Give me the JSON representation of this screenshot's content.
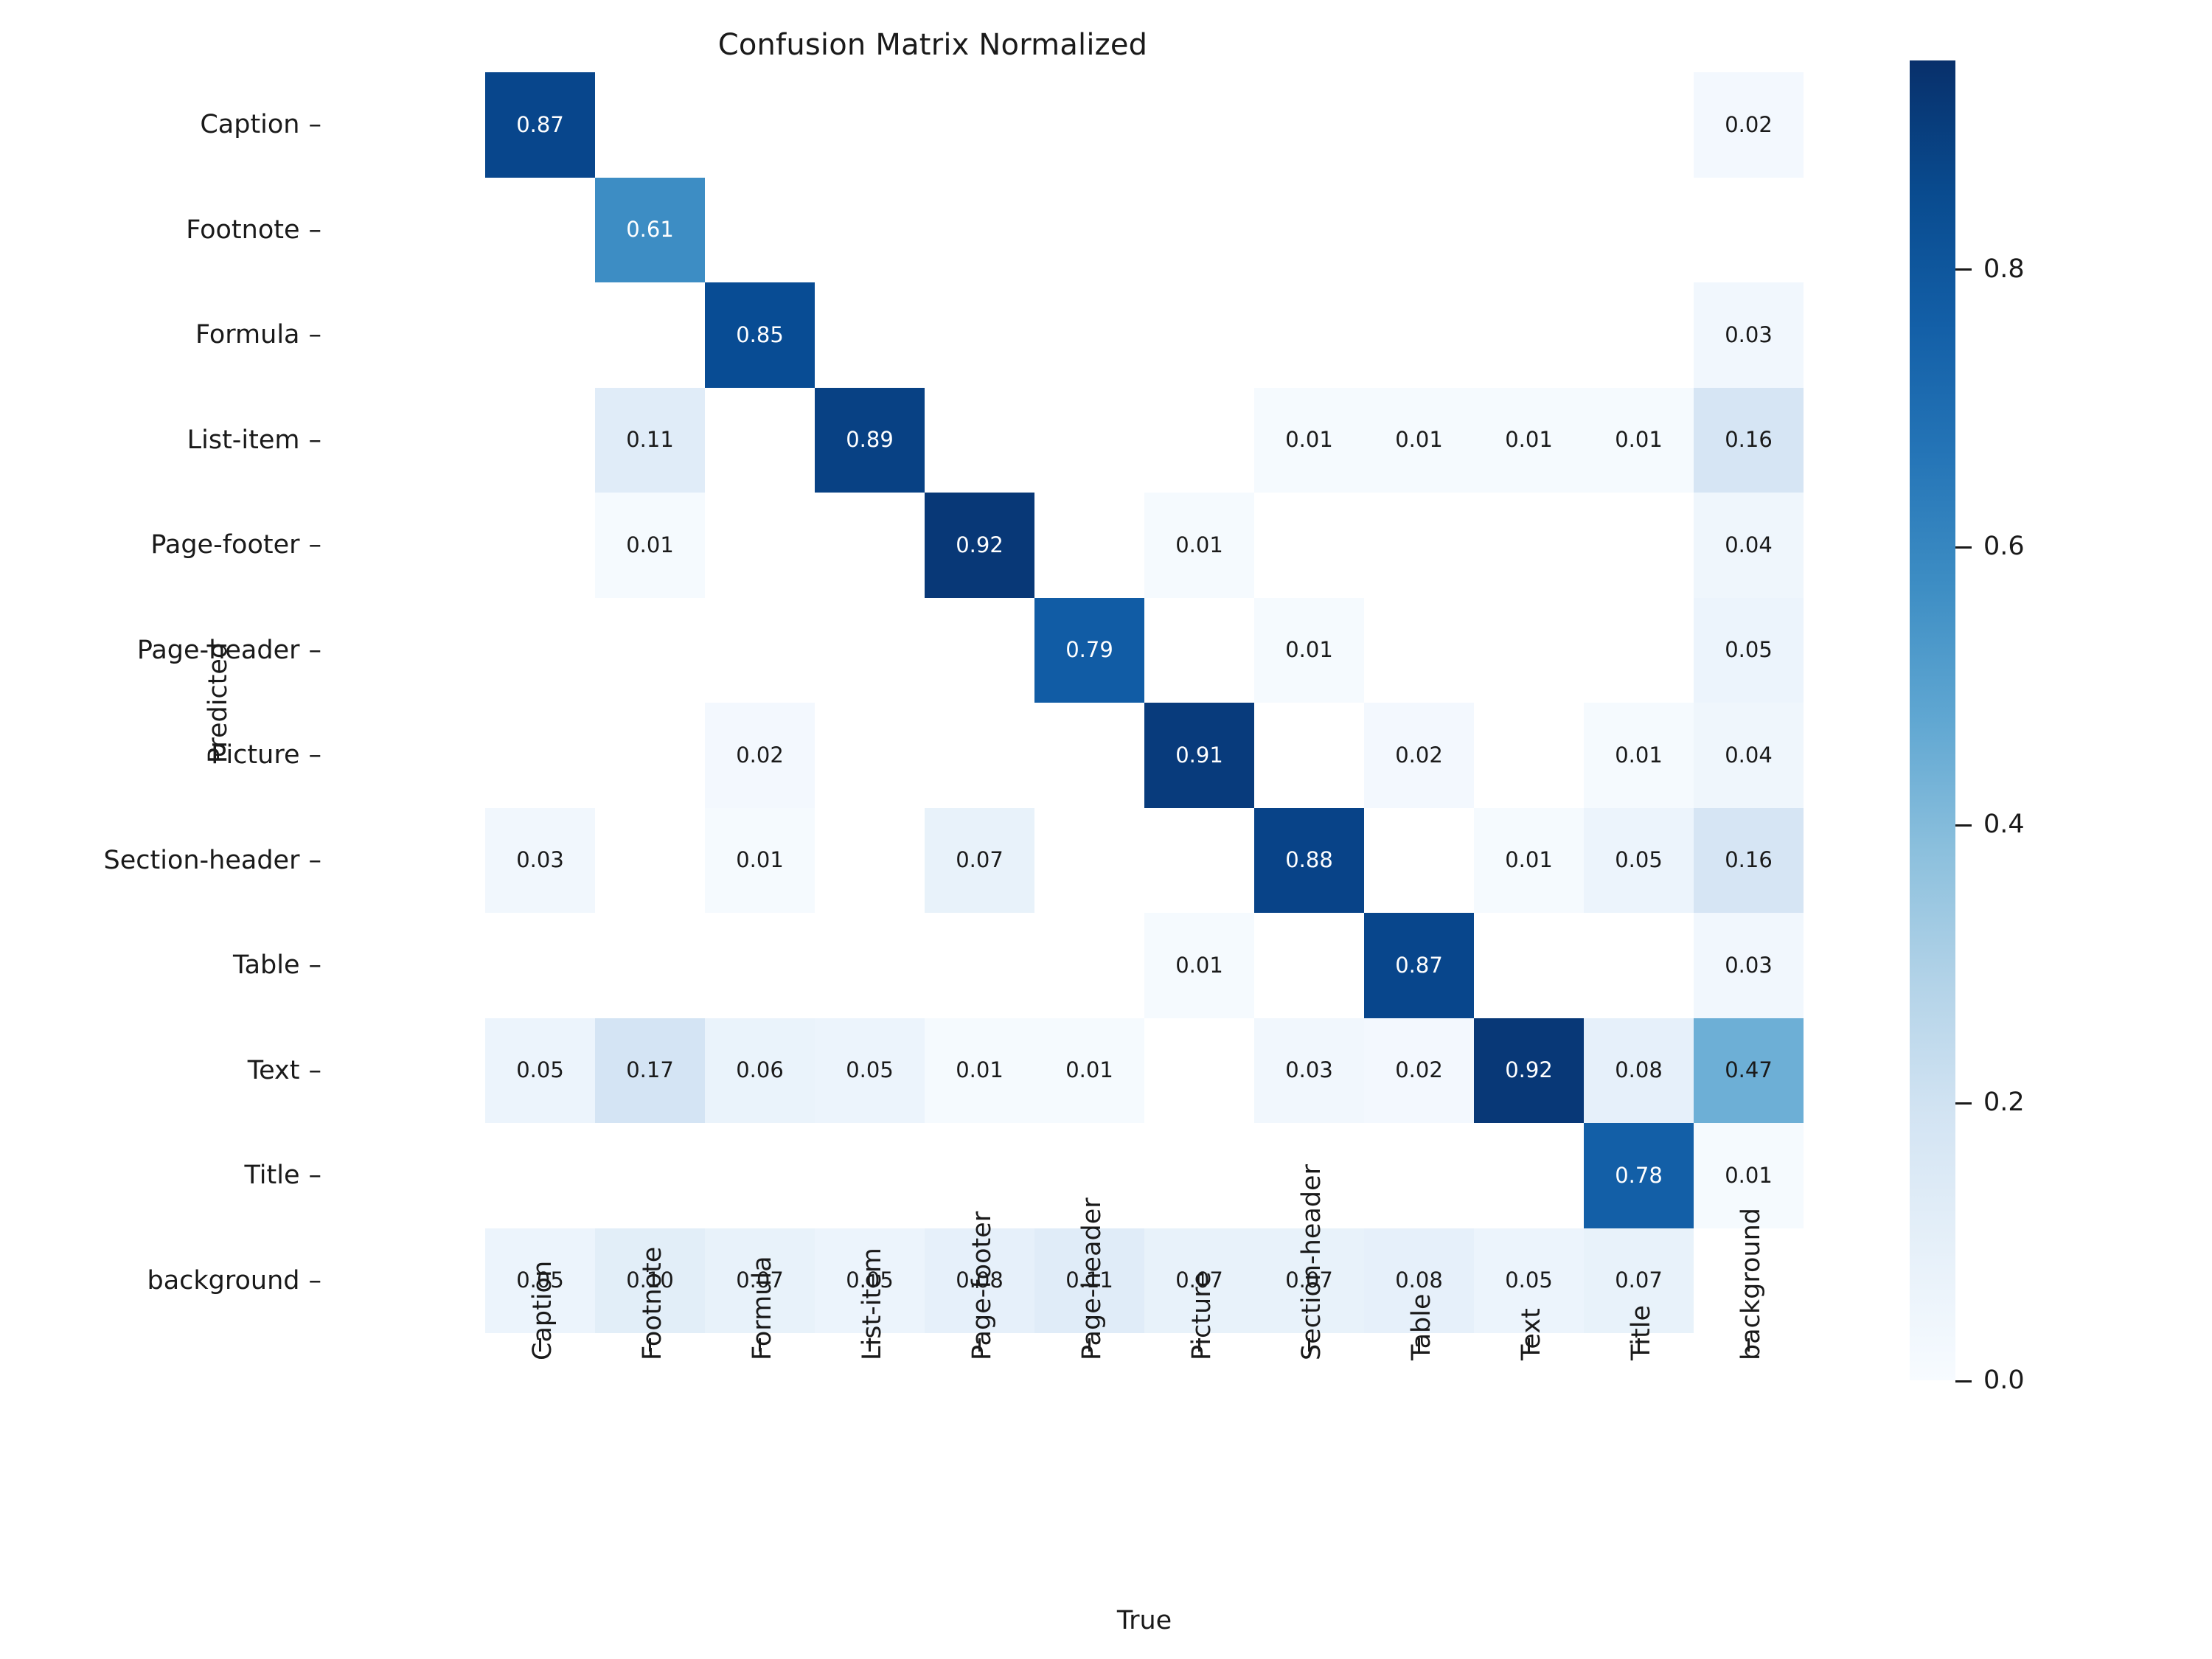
{
  "chart_data": {
    "type": "heatmap",
    "title": "Confusion Matrix Normalized",
    "xlabel": "True",
    "ylabel": "Predicted",
    "grid": false,
    "colormap": "Blues",
    "colorbar": {
      "position": "right",
      "vmin": 0.0,
      "vmax": 0.95,
      "ticks": [
        "0.0",
        "0.2",
        "0.4",
        "0.6",
        "0.8"
      ],
      "tick_values": [
        0.0,
        0.2,
        0.4,
        0.6,
        0.8
      ]
    },
    "categories": [
      "Caption",
      "Footnote",
      "Formula",
      "List-item",
      "Page-footer",
      "Page-header",
      "Picture",
      "Section-header",
      "Table",
      "Text",
      "Title",
      "background"
    ],
    "x_tick_labels": [
      "Caption",
      "Footnote",
      "Formula",
      "List-item",
      "Page-footer",
      "Page-header",
      "Picture",
      "Section-header",
      "Table",
      "Text",
      "Title",
      "background"
    ],
    "y_tick_labels": [
      "Caption",
      "Footnote",
      "Formula",
      "List-item",
      "Page-footer",
      "Page-header",
      "Picture",
      "Section-header",
      "Table",
      "Text",
      "Title",
      "background"
    ],
    "values": [
      [
        0.87,
        null,
        null,
        null,
        null,
        null,
        null,
        null,
        null,
        null,
        null,
        0.02
      ],
      [
        null,
        0.61,
        null,
        null,
        null,
        null,
        null,
        null,
        null,
        null,
        null,
        null
      ],
      [
        null,
        null,
        0.85,
        null,
        null,
        null,
        null,
        null,
        null,
        null,
        null,
        0.03
      ],
      [
        null,
        0.11,
        null,
        0.89,
        null,
        null,
        null,
        0.01,
        0.01,
        0.01,
        0.01,
        0.16
      ],
      [
        null,
        0.01,
        null,
        null,
        0.92,
        null,
        0.01,
        null,
        null,
        null,
        null,
        0.04
      ],
      [
        null,
        null,
        null,
        null,
        null,
        0.79,
        null,
        0.01,
        null,
        null,
        null,
        0.05
      ],
      [
        null,
        null,
        0.02,
        null,
        null,
        null,
        0.91,
        null,
        0.02,
        null,
        0.01,
        0.04
      ],
      [
        0.03,
        null,
        0.01,
        null,
        0.07,
        null,
        null,
        0.88,
        null,
        0.01,
        0.05,
        0.16
      ],
      [
        null,
        null,
        null,
        null,
        null,
        null,
        0.01,
        null,
        0.87,
        null,
        null,
        0.03
      ],
      [
        0.05,
        0.17,
        0.06,
        0.05,
        0.01,
        0.01,
        null,
        0.03,
        0.02,
        0.92,
        0.08,
        0.47
      ],
      [
        null,
        null,
        null,
        null,
        null,
        null,
        null,
        null,
        null,
        null,
        0.78,
        0.01
      ],
      [
        0.05,
        0.1,
        0.07,
        0.05,
        0.08,
        0.11,
        0.07,
        0.07,
        0.08,
        0.05,
        0.07,
        null
      ]
    ],
    "cell_labels": [
      [
        "0.87",
        "",
        "",
        "",
        "",
        "",
        "",
        "",
        "",
        "",
        "",
        "0.02"
      ],
      [
        "",
        "0.61",
        "",
        "",
        "",
        "",
        "",
        "",
        "",
        "",
        "",
        ""
      ],
      [
        "",
        "",
        "0.85",
        "",
        "",
        "",
        "",
        "",
        "",
        "",
        "",
        "0.03"
      ],
      [
        "",
        "0.11",
        "",
        "0.89",
        "",
        "",
        "",
        "0.01",
        "0.01",
        "0.01",
        "0.01",
        "0.16"
      ],
      [
        "",
        "0.01",
        "",
        "",
        "0.92",
        "",
        "0.01",
        "",
        "",
        "",
        "",
        "0.04"
      ],
      [
        "",
        "",
        "",
        "",
        "",
        "0.79",
        "",
        "0.01",
        "",
        "",
        "",
        "0.05"
      ],
      [
        "",
        "",
        "0.02",
        "",
        "",
        "",
        "0.91",
        "",
        "0.02",
        "",
        "0.01",
        "0.04"
      ],
      [
        "0.03",
        "",
        "0.01",
        "",
        "0.07",
        "",
        "",
        "0.88",
        "",
        "0.01",
        "0.05",
        "0.16"
      ],
      [
        "",
        "",
        "",
        "",
        "",
        "",
        "0.01",
        "",
        "0.87",
        "",
        "",
        "0.03"
      ],
      [
        "0.05",
        "0.17",
        "0.06",
        "0.05",
        "0.01",
        "0.01",
        "",
        "0.03",
        "0.02",
        "0.92",
        "0.08",
        "0.47"
      ],
      [
        "",
        "",
        "",
        "",
        "",
        "",
        "",
        "",
        "",
        "",
        "0.78",
        "0.01"
      ],
      [
        "0.05",
        "0.10",
        "0.07",
        "0.05",
        "0.08",
        "0.11",
        "0.07",
        "0.07",
        "0.08",
        "0.05",
        "0.07",
        ""
      ]
    ]
  },
  "colors": {
    "accent_dark": "#08306b",
    "accent_mid": "#3e8ec4",
    "background": "#ffffff",
    "text": "#1a1a1a"
  },
  "axis_tick_dash": "–"
}
